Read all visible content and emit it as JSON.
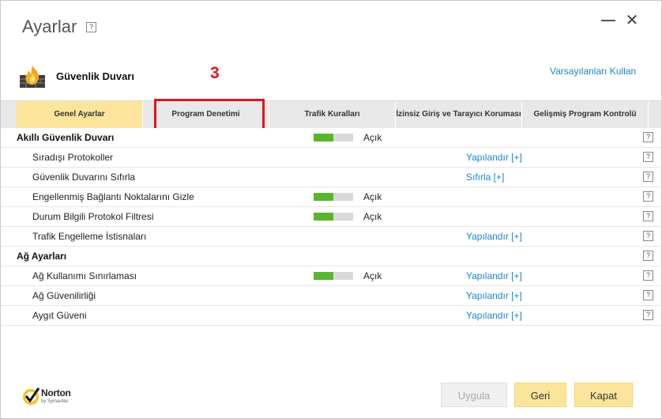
{
  "window": {
    "title": "Ayarlar",
    "help_glyph": "?",
    "minimize_icon": "minimize-icon",
    "close_icon": "close-icon",
    "close_glyph": "✕"
  },
  "header": {
    "section_title": "Güvenlik Duvarı",
    "section_icon": "firewall-icon",
    "step_number": "3",
    "defaults_link": "Varsayılanları Kullan"
  },
  "tabs": [
    {
      "label": "Genel Ayarlar",
      "active": true
    },
    {
      "label": "Program Denetimi",
      "active": false,
      "highlighted": true
    },
    {
      "label": "Trafik Kuralları",
      "active": false
    },
    {
      "label": "İzinsiz Giriş ve Tarayıcı Koruması",
      "active": false
    },
    {
      "label": "Gelişmiş Program Kontrolü",
      "active": false
    }
  ],
  "rows": [
    {
      "type": "section",
      "label": "Akıllı Güvenlik Duvarı",
      "toggle": true,
      "toggle_level": 0.5,
      "status": "Açık",
      "action": "",
      "help": "?"
    },
    {
      "type": "item",
      "label": "Sıradışı Protokoller",
      "toggle": false,
      "status": "",
      "action": "Yapılandır [+]",
      "help": "?"
    },
    {
      "type": "item",
      "label": "Güvenlik Duvarını Sıfırla",
      "toggle": false,
      "status": "",
      "action": "Sıfırla [+]",
      "help": "?"
    },
    {
      "type": "item",
      "label": "Engellenmiş Bağlantı Noktalarını Gizle",
      "toggle": true,
      "toggle_level": 0.5,
      "status": "Açık",
      "action": "",
      "help": "?"
    },
    {
      "type": "item",
      "label": "Durum Bilgili Protokol Filtresi",
      "toggle": true,
      "toggle_level": 0.5,
      "status": "Açık",
      "action": "",
      "help": "?"
    },
    {
      "type": "item",
      "label": "Trafik Engelleme İstisnaları",
      "toggle": false,
      "status": "",
      "action": "Yapılandır [+]",
      "help": "?"
    },
    {
      "type": "section",
      "label": "Ağ Ayarları",
      "toggle": false,
      "status": "",
      "action": "",
      "help": "?"
    },
    {
      "type": "item",
      "label": "Ağ Kullanımı Sınırlaması",
      "toggle": true,
      "toggle_level": 0.5,
      "status": "Açık",
      "action": "Yapılandır [+]",
      "help": "?"
    },
    {
      "type": "item",
      "label": "Ağ Güvenilirliği",
      "toggle": false,
      "status": "",
      "action": "Yapılandır [+]",
      "help": "?"
    },
    {
      "type": "item",
      "label": "Aygıt Güveni",
      "toggle": false,
      "status": "",
      "action": "Yapılandır [+]",
      "help": "?"
    }
  ],
  "footer": {
    "logo_name": "Norton",
    "logo_sub": "by Symantec",
    "apply_label": "Uygula",
    "apply_enabled": false,
    "back_label": "Geri",
    "close_label": "Kapat"
  },
  "colors": {
    "accent": "#fce59a",
    "link": "#1a86c8",
    "toggle_on": "#5ab52e",
    "highlight": "#e0161c"
  }
}
